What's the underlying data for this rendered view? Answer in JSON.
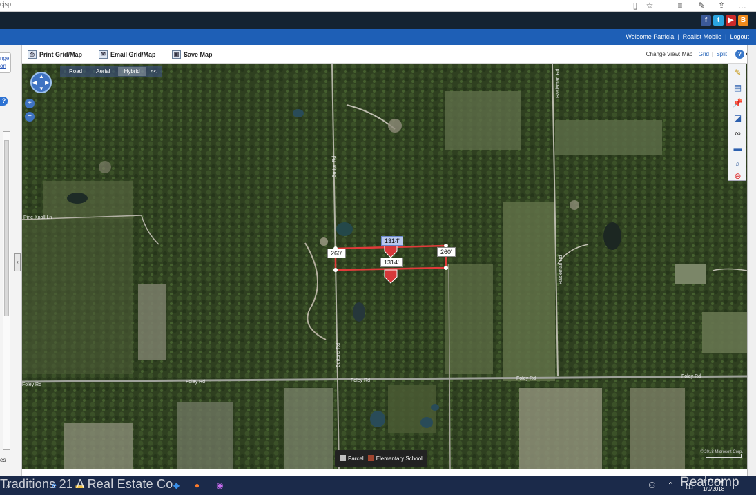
{
  "browser": {
    "url_fragment": "cjsp",
    "icons": [
      "reading-view-icon",
      "favorite-star-icon",
      "hub-icon",
      "notes-icon",
      "share-icon",
      "more-icon"
    ]
  },
  "header": {
    "social": [
      {
        "name": "facebook",
        "glyph": "f",
        "color": "#3b5998"
      },
      {
        "name": "twitter",
        "glyph": "t",
        "color": "#2ba5e0"
      },
      {
        "name": "youtube",
        "glyph": "▶",
        "color": "#cc2a2a"
      },
      {
        "name": "blogger",
        "glyph": "B",
        "color": "#f08a1c"
      }
    ],
    "welcome": "Welcome Patricia",
    "mobile": "Realist Mobile",
    "logout": "Logout"
  },
  "leftpanel": {
    "link1": "nge",
    "link2": "on",
    "help": "?",
    "toggle": "‹",
    "bottom": "es"
  },
  "toolbar": {
    "print": "Print Grid/Map",
    "email": "Email Grid/Map",
    "save": "Save Map",
    "change_view_label": "Change View:",
    "view_map": "Map",
    "view_grid": "Grid",
    "view_split": "Split",
    "help": "?"
  },
  "map": {
    "tabs": {
      "road": "Road",
      "aerial": "Aerial",
      "hybrid": "Hybrid",
      "collapse": "<<"
    },
    "selected_tab": "Hybrid",
    "zoom_in": "+",
    "zoom_out": "−",
    "roads": {
      "sutton_upper": "Sutton Rd",
      "pine_knoll": "Pine Knoll Ln",
      "hasleman_upper": "Hasleman Rd",
      "burtons": "Burtons Rd",
      "hasleman_lower": "Hasleman Rd",
      "foley_1": "Foley Rd",
      "foley_2": "Foley Rd",
      "foley_3": "Foley Rd",
      "foley_4": "Foley Rd",
      "foley_5": "Foley Rd"
    },
    "dimensions": {
      "left": "260'",
      "right": "260'",
      "top": "1314'",
      "bottom": "1314'"
    },
    "legend": {
      "parcel": "Parcel",
      "school": "Elementary School",
      "parcel_color": "#bfbfbf",
      "school_color": "#a0452f"
    },
    "attribution": "© 2018 Microsoft Corp.",
    "parcel_outline_color": "#e23a3a"
  },
  "righttools": [
    "pencil-icon",
    "layers-icon",
    "pin-icon",
    "chart-icon",
    "binoculars-icon",
    "car-icon",
    "magnifier-icon",
    "stop-icon"
  ],
  "taskbar": {
    "time": "1:27 PM",
    "date": "1/9/2018"
  },
  "watermark": {
    "left": "Traditions 21 A Real Estate Co",
    "right": "Realcomp"
  }
}
